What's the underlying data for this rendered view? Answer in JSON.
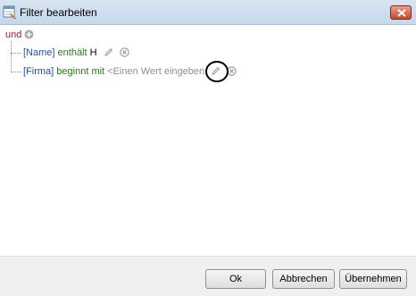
{
  "window": {
    "title": "Filter bearbeiten",
    "icon": "filter-edit-icon",
    "close_icon": "close-icon"
  },
  "filter": {
    "root": {
      "label": "und",
      "add_icon": "plus-circle-icon"
    },
    "conditions": [
      {
        "field": "[Name]",
        "operator": "enthält",
        "value": "H",
        "edit_icon": "pencil-icon",
        "remove_icon": "remove-circle-icon"
      },
      {
        "field": "[Firma]",
        "operator": "beginnt mit",
        "value": "<Einen Wert eingeben",
        "edit_icon": "pencil-icon",
        "remove_icon": "remove-circle-icon"
      }
    ]
  },
  "buttons": {
    "ok": "Ok",
    "cancel": "Abbrechen",
    "apply": "Übernehmen"
  },
  "colors": {
    "root_operator": "#b0151b",
    "field": "#1f4f9e",
    "condition_operator": "#287a1a",
    "placeholder": "#8f8f8f",
    "titlebar": "#d7e4f2"
  }
}
